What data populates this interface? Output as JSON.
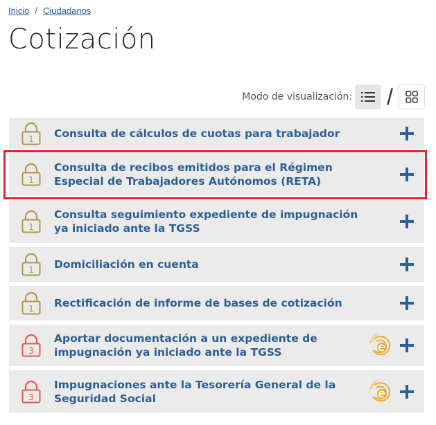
{
  "breadcrumb": {
    "home": "Inicio",
    "separator": "/",
    "section": "Ciudadanos"
  },
  "page": {
    "title": "Cotización"
  },
  "view_mode": {
    "label": "Modo de visualización:",
    "separator": "/",
    "list_icon": "list-icon",
    "grid_icon": "grid-icon"
  },
  "colors": {
    "link": "#2c5f96",
    "level1": "#b09a4e",
    "level3": "#e35b4a",
    "registro": "#f0a531",
    "highlight": "#e0242b",
    "item_bg": "#ebebeb"
  },
  "procedures": [
    {
      "title": "Consulta de cálculos de cuotas para trabajador",
      "level": "1",
      "registro": false
    },
    {
      "title": "Consulta de recibos emitidos para el Régimen Especial de Trabajadores Autónomos (RETA)",
      "level": "1",
      "registro": false,
      "highlighted": true
    },
    {
      "title": "Consulta seguimiento expediente de impugnación ya iniciado ante la TGSS",
      "level": "1",
      "registro": false
    },
    {
      "title": "Domiciliación en cuenta",
      "level": "1",
      "registro": false
    },
    {
      "title": "Rectificación de informe de bases de cotización",
      "level": "1",
      "registro": false
    },
    {
      "title": "Aportar documentación a un expediente de impugnación ya iniciado ante la TGSS",
      "level": "3",
      "registro": true,
      "registro_label": "registro"
    },
    {
      "title": "Impugnaciones ante la Tesorería General de la Seguridad Social",
      "level": "3",
      "registro": true,
      "registro_label": "registro"
    }
  ]
}
